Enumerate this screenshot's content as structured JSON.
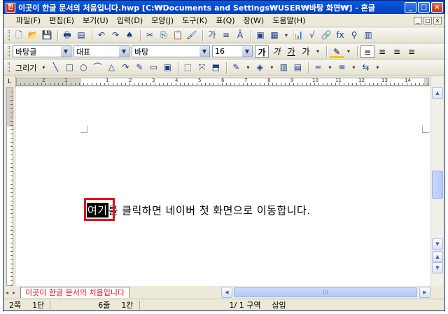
{
  "window": {
    "title": "이곳이 한글 문서의 처음입니다.hwp [C:₩Documents and Settings₩USER₩바탕 화면₩] - 혼글",
    "app_icon": "한",
    "controls": [
      "_",
      "□",
      "×"
    ]
  },
  "menu": {
    "items": [
      "파일(F)",
      "편집(E)",
      "보기(U)",
      "입력(D)",
      "모양(J)",
      "도구(K)",
      "표(Q)",
      "창(W)",
      "도움말(H)"
    ],
    "mini_controls": [
      "_",
      "□",
      "×"
    ]
  },
  "toolbar1": {
    "icons": [
      "new-doc-icon",
      "open-icon",
      "save-icon",
      "print-icon",
      "preview-icon",
      "undo-icon",
      "redo-icon",
      "find-icon",
      "cut-icon",
      "copy-icon",
      "paste-icon",
      "format-paint-icon",
      "char-shape-icon",
      "para-shape-icon",
      "style-icon",
      "table-icon",
      "chart-icon",
      "formula-icon",
      "image-icon",
      "hyperlink-icon",
      "insert-icon",
      "fx-icon",
      "extra-icon"
    ],
    "glyphs": [
      "🗋",
      "📂",
      "💾",
      "🖶",
      "▤",
      "↶",
      "↷",
      "♠",
      "✂",
      "⎘",
      "📋",
      "🖌",
      "가",
      "≡",
      "Ā",
      "▦",
      "📊",
      "√",
      "▣",
      "🔗",
      "⚲",
      "fx",
      "▥"
    ]
  },
  "toolbar2": {
    "style_combo": "바탕글",
    "script_combo": "대표",
    "font_combo": "바탕",
    "size_combo": "16",
    "format_buttons": [
      "가",
      "가",
      "가",
      "가"
    ],
    "align_buttons": [
      "≡",
      "≡",
      "≡",
      "≡"
    ]
  },
  "toolbar3": {
    "draw_label": "그리기",
    "shapes": [
      "╲",
      "□",
      "○",
      "⌒",
      "△",
      "↷",
      "✎",
      "▭",
      "▣",
      "⬚",
      "⤧",
      "⬒",
      "✎",
      "◈",
      "▥",
      "▤",
      "═",
      "≡",
      "⇆"
    ]
  },
  "ruler": {
    "corner": "L",
    "numbers": [
      "1",
      "2",
      "1",
      "2",
      "3",
      "4",
      "5",
      "6",
      "7",
      "8",
      "9",
      "10",
      "11",
      "12",
      "13",
      "14",
      "15"
    ]
  },
  "document": {
    "selected_text": "여기",
    "rest_text": "를 클릭하면 네이버 첫 화면으로 이동합니다."
  },
  "tabs": {
    "nav": [
      "◂",
      "▸"
    ],
    "active_tab": "이곳이 한글 문서의 처음입니다"
  },
  "status": {
    "page": "2쪽",
    "section": "1단",
    "line": "6줄",
    "column": "1칸",
    "page_of": "1/ 1 구역",
    "mode": "삽입"
  },
  "colors": {
    "titlebar": "#0349c9",
    "highlight_outline": "#e8101a",
    "tab_text": "#e8101a"
  }
}
